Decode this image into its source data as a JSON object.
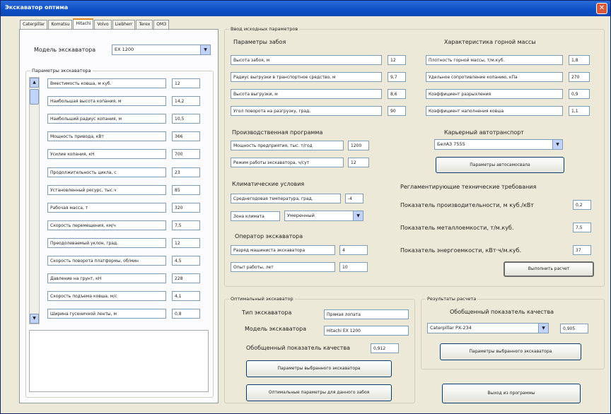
{
  "window": {
    "title": "Экскаватор оптима",
    "close_glyph": "✕"
  },
  "tabs": [
    "Caterpillar",
    "Komatsu",
    "Hitachi",
    "Volvo",
    "Liebherr",
    "Terex",
    "ОМЗ"
  ],
  "active_tab": "Hitachi",
  "left": {
    "model_label": "Модель экскаватора",
    "model_value": "EX 1200",
    "params_group": "Параметры экскаватора",
    "params": [
      {
        "label": "Вместимость ковша, м куб.",
        "value": "12"
      },
      {
        "label": "Наибольшая высота копания, м",
        "value": "14,2"
      },
      {
        "label": "Наибольший радиус копания, м",
        "value": "10,5"
      },
      {
        "label": "Мощность привода, кВт",
        "value": "366"
      },
      {
        "label": "Усилие копания, кН",
        "value": "700"
      },
      {
        "label": "Продолжительность цикла, с",
        "value": "23"
      },
      {
        "label": "Установленный ресурс, тыс.ч",
        "value": "85"
      },
      {
        "label": "Рабочая масса, т",
        "value": "320"
      },
      {
        "label": "Скорость перемещения, км/ч",
        "value": "7,5"
      },
      {
        "label": "Преодолеваемый уклон, град.",
        "value": "12"
      },
      {
        "label": "Скорость поворота платформы, об/мин",
        "value": "4,5"
      },
      {
        "label": "Давление на грунт, кН",
        "value": "228"
      },
      {
        "label": "Скорость подъема ковша, м/с",
        "value": "4,1"
      },
      {
        "label": "Ширина гусеничной ленты, м",
        "value": "0,8"
      }
    ]
  },
  "input": {
    "group": "Ввод исходных параметров",
    "face_group": "Параметры забоя",
    "face": [
      {
        "label": "Высота забоя, м",
        "value": "12"
      },
      {
        "label": "Радиус выгрузки в транспортное средство, м",
        "value": "9,7"
      },
      {
        "label": "Высота выгрузки, м",
        "value": "8,6"
      },
      {
        "label": "Угол поворота на разгрузку, град.",
        "value": "90"
      }
    ],
    "rock_title": "Характеристика горной массы",
    "rock": [
      {
        "label": "Плотность горной массы, т/м.куб.",
        "value": "1,8"
      },
      {
        "label": "Удельное сопротивление копанию, кПа",
        "value": "270"
      },
      {
        "label": "Коэффициент разрыхления",
        "value": "0,9"
      },
      {
        "label": "Коэффициент наполнения ковша",
        "value": "1,1"
      }
    ],
    "prod_title": "Производственная программа",
    "prod": [
      {
        "label": "Мощность предприятия, тыс. т/год",
        "value": "1200"
      },
      {
        "label": "Режим работы экскаватора, ч/сут",
        "value": "12"
      }
    ],
    "truck_title": "Карьерный автотранспорт",
    "truck_value": "БелАЗ 7555",
    "truck_button": "Параметры автосамосвала",
    "climate_title": "Климатические условия",
    "climate_label": "Среднегодовая температура, град.",
    "climate_value": "-4",
    "zone_label": "Зона климата",
    "zone_value": "Умеренный",
    "operator_title": "Оператор экскаватора",
    "operator": [
      {
        "label": "Разряд машиниста экскаватора",
        "value": "4"
      },
      {
        "label": "Опыт работы, лет",
        "value": "10"
      }
    ],
    "req_title": "Регламентирующие технические требования",
    "req": [
      {
        "label": "Показатель производительности, м куб./кВт",
        "value": "0,2"
      },
      {
        "label": "Показатель металлоемкости, т/м.куб.",
        "value": "7,5"
      },
      {
        "label": "Показатель энергоемкости, кВт·ч/м.куб.",
        "value": "37"
      }
    ],
    "calc_button": "Выполнить расчет"
  },
  "optimal": {
    "group": "Оптимальный экскаватор",
    "type_label": "Тип экскаватора",
    "type_value": "Прямая лопата",
    "model_label": "Модель экскаватора",
    "model_value": "Hitachi EX 1200",
    "quality_label": "Обобщенный показатель качества",
    "quality_value": "0,912",
    "params_button": "Параметры выбранного экскаватора",
    "opt_button": "Оптимальные параметры для данного забоя"
  },
  "results": {
    "group": "Результаты расчета",
    "quality_title": "Обобщенный показатель качества",
    "select_value": "Caterpillar PX-234",
    "quality_value": "0,905",
    "params_button": "Параметры выбранного экскаватора",
    "exit_button": "Выход из программы"
  },
  "icons": {
    "up": "▲",
    "down": "▼"
  }
}
